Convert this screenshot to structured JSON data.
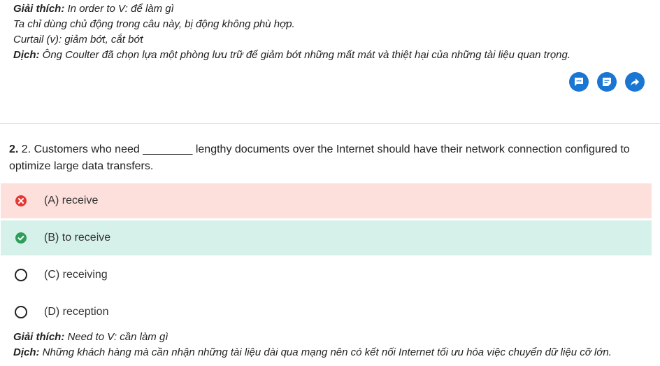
{
  "top_explanation": {
    "line1_label": "Giải thích:",
    "line1_text": " In order to V: để làm gì",
    "line2_text": "Ta chỉ dùng chủ động trong câu này, bị động không phù hợp.",
    "line3_text": "Curtail (v): giảm bớt, cắt bớt",
    "line4_label": "Dịch:",
    "line4_text": " Ông Coulter đã chọn lựa một phòng lưu trữ để giảm bớt những mất mát và thiệt hại của những tài liệu quan trọng."
  },
  "actions": {
    "icons": [
      "comment-icon",
      "note-icon",
      "share-icon"
    ],
    "color": "#1976d2"
  },
  "question": {
    "number": "2.",
    "text": " 2. Customers who need ________ lengthy documents over the Internet should have their network connection configured to optimize large data transfers."
  },
  "options": [
    {
      "label": "(A) receive",
      "state": "wrong"
    },
    {
      "label": "(B) to receive",
      "state": "correct"
    },
    {
      "label": "(C) receiving",
      "state": "none"
    },
    {
      "label": "(D) reception",
      "state": "none"
    }
  ],
  "bottom_explanation": {
    "line1_label": "Giải thích:",
    "line1_text": " Need to V: cần làm gì",
    "line2_label": "Dịch:",
    "line2_text": " Những khách hàng mà cần nhận những tài liệu dài qua mạng nên có kết nối Internet tối ưu hóa việc chuyển dữ liệu cỡ lớn."
  },
  "colors": {
    "wrong_bg": "#fde0dc",
    "correct_bg": "#d6f1e9",
    "wrong_icon": "#e53935",
    "correct_icon": "#2e9e5b"
  }
}
